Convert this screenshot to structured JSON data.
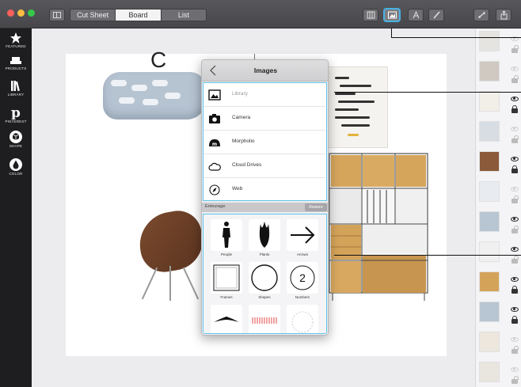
{
  "titlebar": {
    "tabs": [
      {
        "label": "Cut Sheet",
        "active": false
      },
      {
        "label": "Board",
        "active": true
      },
      {
        "label": "List",
        "active": false
      }
    ],
    "tools": [
      "grid-icon",
      "images-icon",
      "text-icon",
      "pen-icon",
      "link-icon",
      "share-icon"
    ],
    "active_tool": "images-icon",
    "highlight_color": "#46b3e6"
  },
  "left_toolbar": {
    "items": [
      {
        "label": "FEATURED",
        "icon": "star-icon"
      },
      {
        "label": "PRODUCTS",
        "icon": "sofa-icon"
      },
      {
        "label": "LIBRARY",
        "icon": "books-icon"
      },
      {
        "label": "PINTEREST",
        "icon": "pinterest-icon"
      },
      {
        "label": "SHAPE",
        "icon": "cube-icon"
      },
      {
        "label": "COLOR",
        "icon": "drop-icon"
      }
    ]
  },
  "board": {
    "partial_title": "C"
  },
  "images_panel": {
    "title": "Images",
    "sources": [
      {
        "label": "Library",
        "icon": "picture-icon"
      },
      {
        "label": "Camera",
        "icon": "camera-icon"
      },
      {
        "label": "Morpholio",
        "icon": "morpholio-icon"
      },
      {
        "label": "Cloud Drives",
        "icon": "cloud-icon"
      },
      {
        "label": "Web",
        "icon": "compass-icon"
      }
    ],
    "entourage": {
      "label": "Entourage",
      "button_label": "Restore",
      "tiles": [
        {
          "label": "People",
          "icon": "person-silhouette-icon"
        },
        {
          "label": "Plants",
          "icon": "plant-silhouette-icon"
        },
        {
          "label": "Arrows",
          "icon": "arrow-icon"
        },
        {
          "label": "Frames",
          "icon": "frame-icon"
        },
        {
          "label": "Shapes",
          "icon": "circle-icon"
        },
        {
          "label": "Numbers",
          "icon": "number-icon",
          "value": "2"
        },
        {
          "label": "",
          "icon": "boomerang-icon"
        },
        {
          "label": "",
          "icon": "hatch-icon"
        },
        {
          "label": "",
          "icon": "dashed-circle-icon"
        }
      ]
    },
    "accent_color": "#5ec3ea"
  },
  "thumbnails": [
    {
      "visible": false,
      "locked": false
    },
    {
      "visible": false,
      "locked": false
    },
    {
      "visible": true,
      "locked": true
    },
    {
      "visible": false,
      "locked": false
    },
    {
      "visible": true,
      "locked": true
    },
    {
      "visible": false,
      "locked": false
    },
    {
      "visible": true,
      "locked": false
    },
    {
      "visible": true,
      "locked": false
    },
    {
      "visible": true,
      "locked": true
    },
    {
      "visible": true,
      "locked": true
    },
    {
      "visible": false,
      "locked": false
    },
    {
      "visible": false,
      "locked": false
    }
  ]
}
